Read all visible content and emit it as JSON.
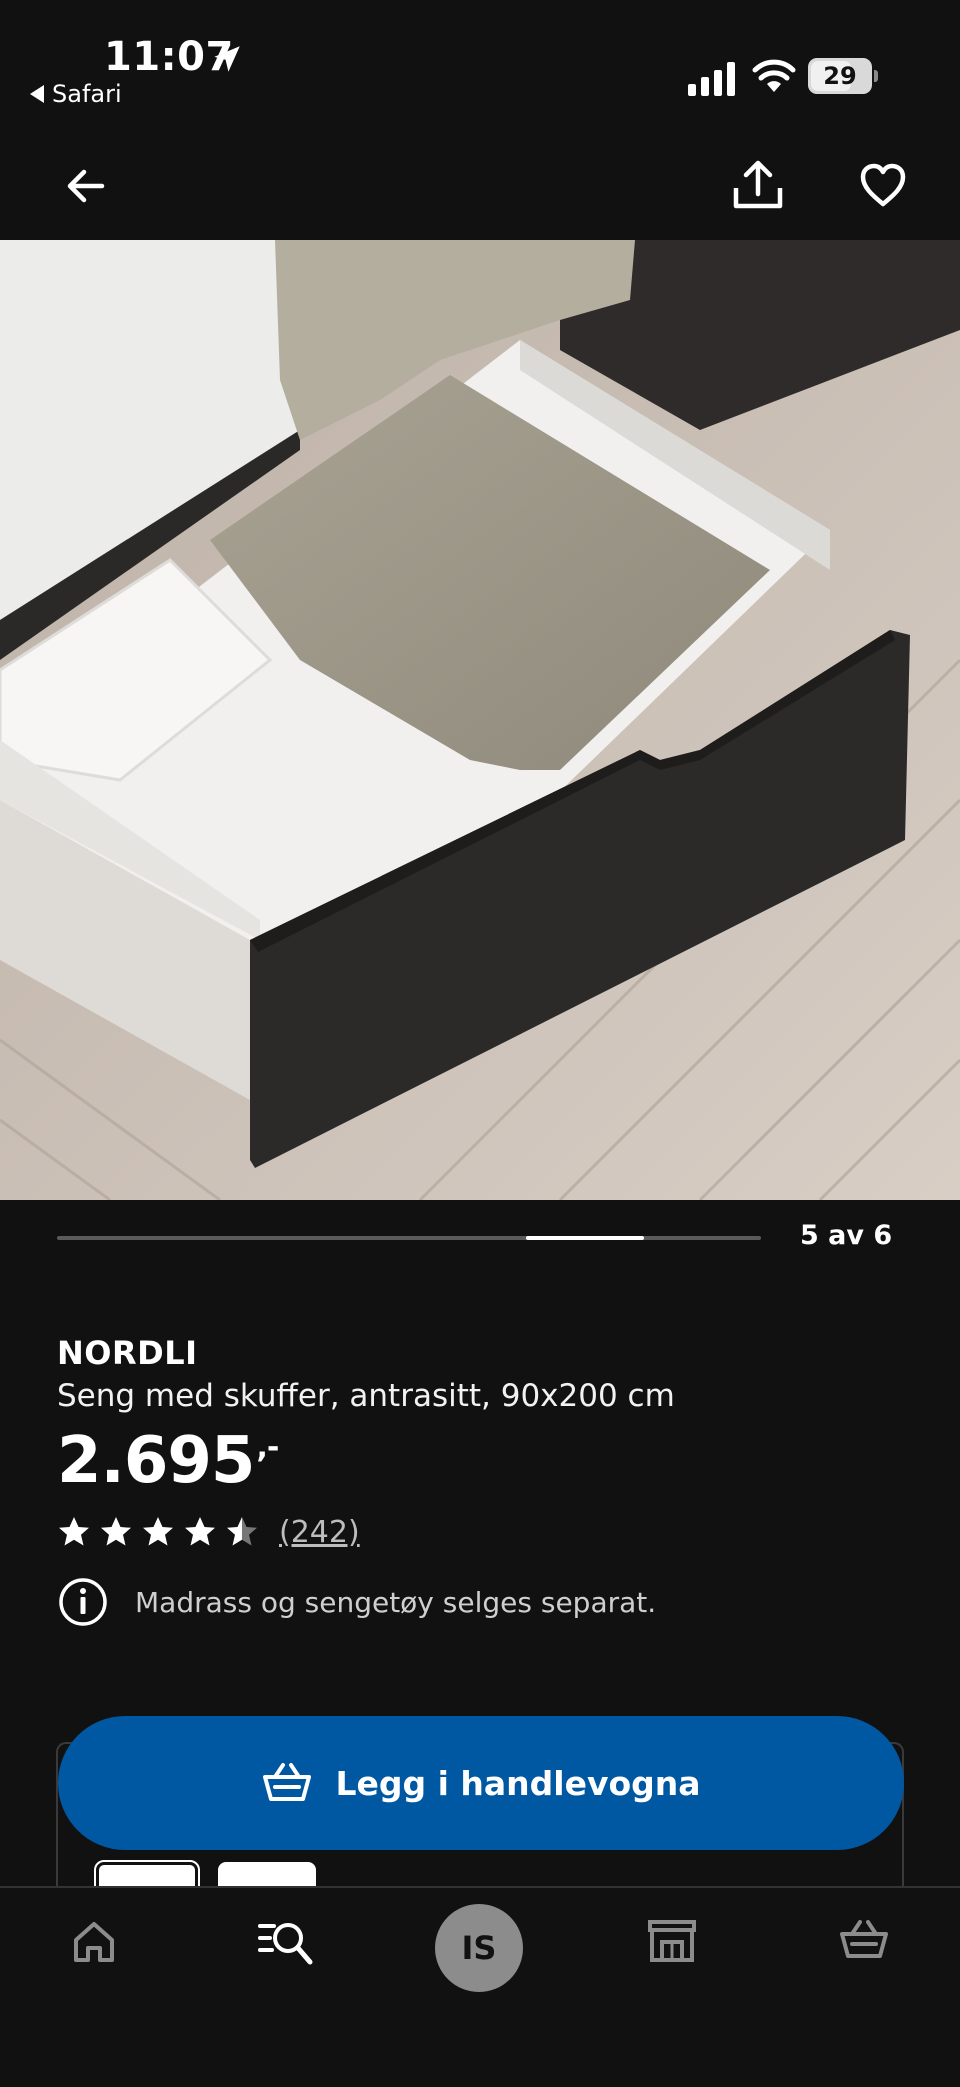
{
  "status_bar": {
    "time": "11:07",
    "back_app": "Safari",
    "battery": "29"
  },
  "top_nav": {
    "back_icon": "arrow-left-icon",
    "share_icon": "share-icon",
    "favourite_icon": "heart-icon"
  },
  "gallery": {
    "counter": "5 av 6",
    "current": 5,
    "total": 6
  },
  "product": {
    "brand": "NORDLI",
    "description": "Seng med skuffer, antrasitt, 90x200 cm",
    "price": "2.695",
    "price_suffix": ",-",
    "rating": 4.5,
    "rating_max": 5,
    "review_count": "(242)",
    "notice": "Madrass og sengetøy selges separat."
  },
  "cart": {
    "button_label": "Legg i handlevogna"
  },
  "tab_bar": {
    "profile_initials": "IS",
    "items": [
      "home-icon",
      "search-icon",
      "profile-avatar",
      "store-icon",
      "basket-icon"
    ]
  },
  "colors": {
    "background": "#111111",
    "primary_button": "#0058a3",
    "text": "#ffffff",
    "muted_text": "#cfcfcf"
  }
}
